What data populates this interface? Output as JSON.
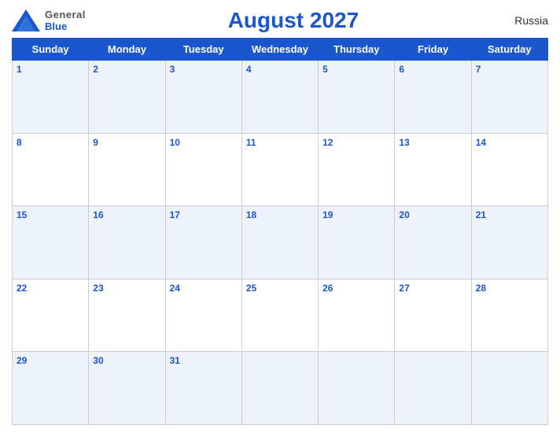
{
  "header": {
    "logo": {
      "general": "General",
      "blue": "Blue"
    },
    "title": "August 2027",
    "country": "Russia"
  },
  "weekdays": [
    "Sunday",
    "Monday",
    "Tuesday",
    "Wednesday",
    "Thursday",
    "Friday",
    "Saturday"
  ],
  "weeks": [
    [
      1,
      2,
      3,
      4,
      5,
      6,
      7
    ],
    [
      8,
      9,
      10,
      11,
      12,
      13,
      14
    ],
    [
      15,
      16,
      17,
      18,
      19,
      20,
      21
    ],
    [
      22,
      23,
      24,
      25,
      26,
      27,
      28
    ],
    [
      29,
      30,
      31,
      null,
      null,
      null,
      null
    ]
  ]
}
